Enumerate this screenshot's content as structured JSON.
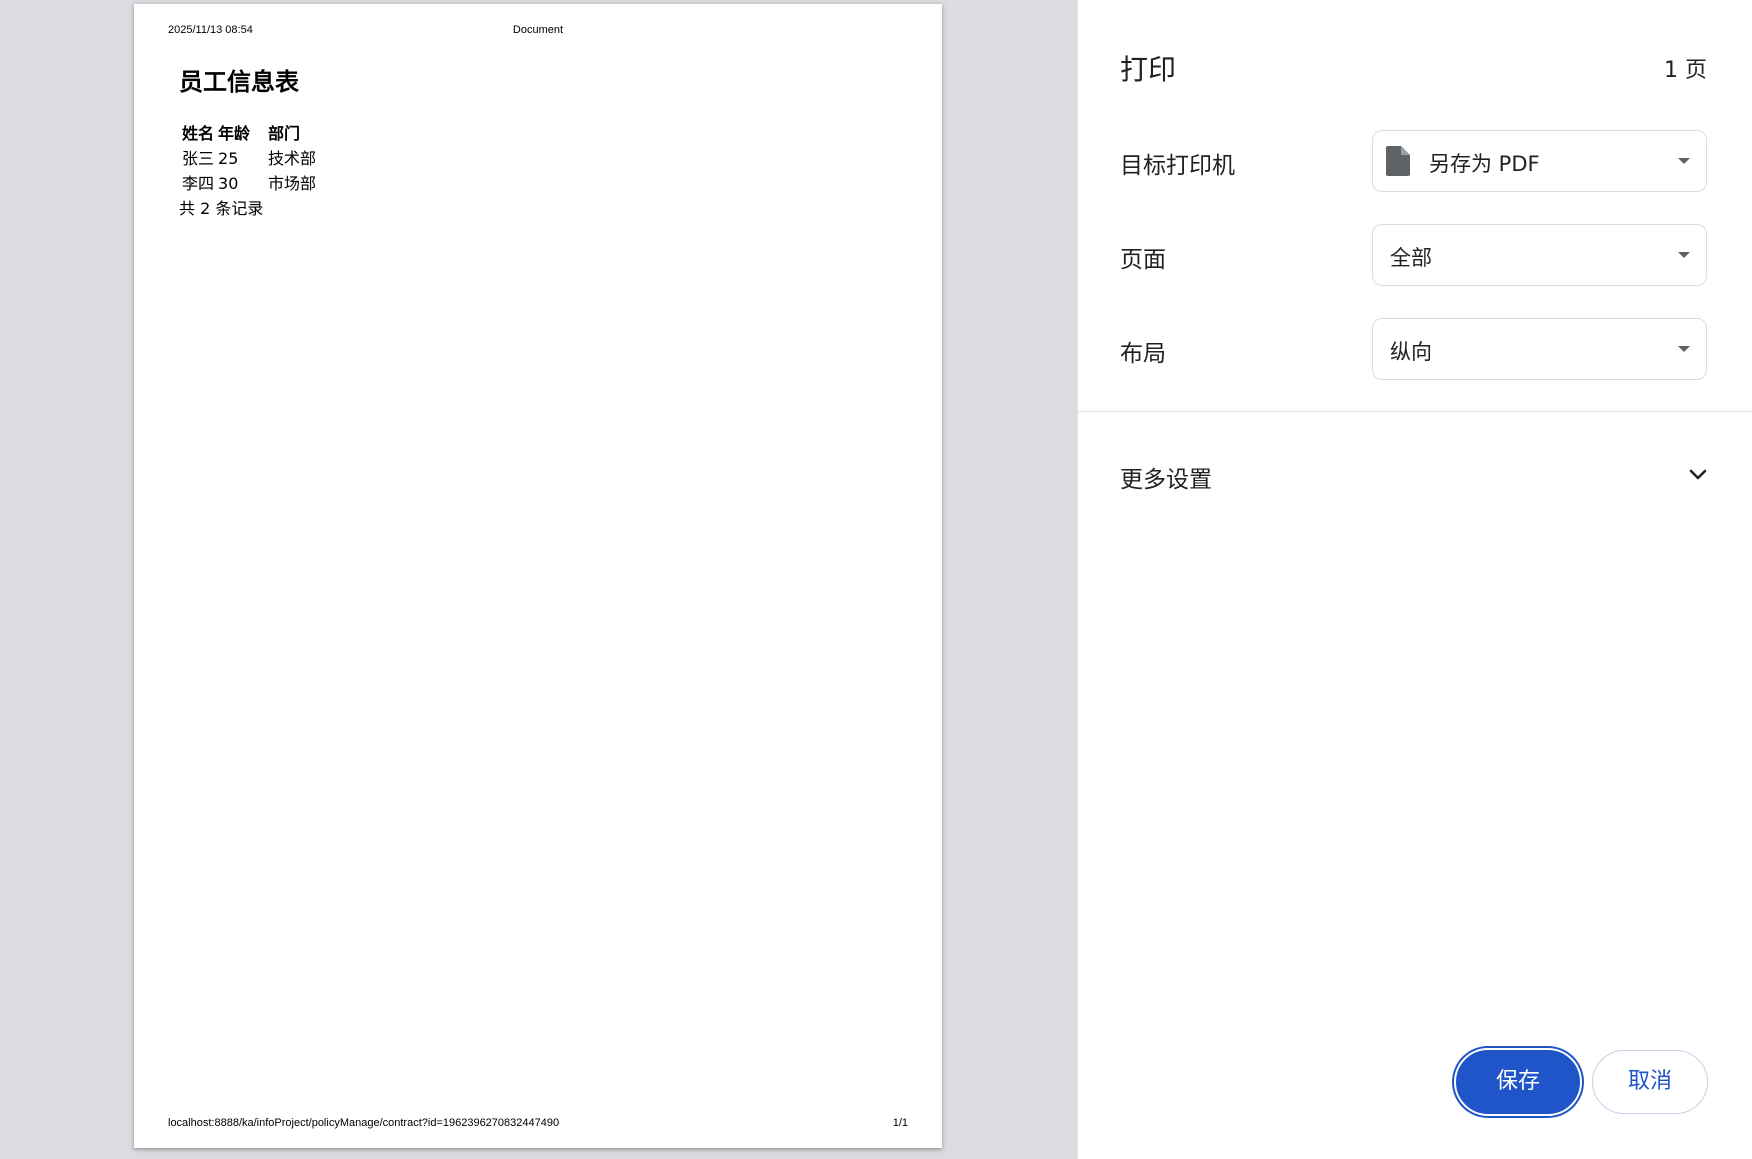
{
  "preview": {
    "header_date": "2025/11/13 08:54",
    "header_title": "Document",
    "heading": "员工信息表",
    "table": {
      "columns": [
        "姓名",
        "年龄",
        "部门"
      ],
      "rows": [
        [
          "张三",
          "25",
          "技术部"
        ],
        [
          "李四",
          "30",
          "市场部"
        ]
      ]
    },
    "record_count": "共 2 条记录",
    "footer_url": "localhost:8888/ka/infoProject/policyManage/contract?id=1962396270832447490",
    "footer_page": "1/1"
  },
  "sidebar": {
    "title": "打印",
    "page_count": "1 页",
    "destination": {
      "label": "目标打印机",
      "value": "另存为 PDF",
      "icon": "file-icon"
    },
    "pages": {
      "label": "页面",
      "value": "全部"
    },
    "layout": {
      "label": "布局",
      "value": "纵向"
    },
    "more_settings": {
      "label": "更多设置",
      "icon": "chevron-down-icon"
    },
    "save_label": "保存",
    "cancel_label": "取消"
  },
  "colors": {
    "accent": "#1f55c9",
    "preview_bg": "#dadce0"
  }
}
